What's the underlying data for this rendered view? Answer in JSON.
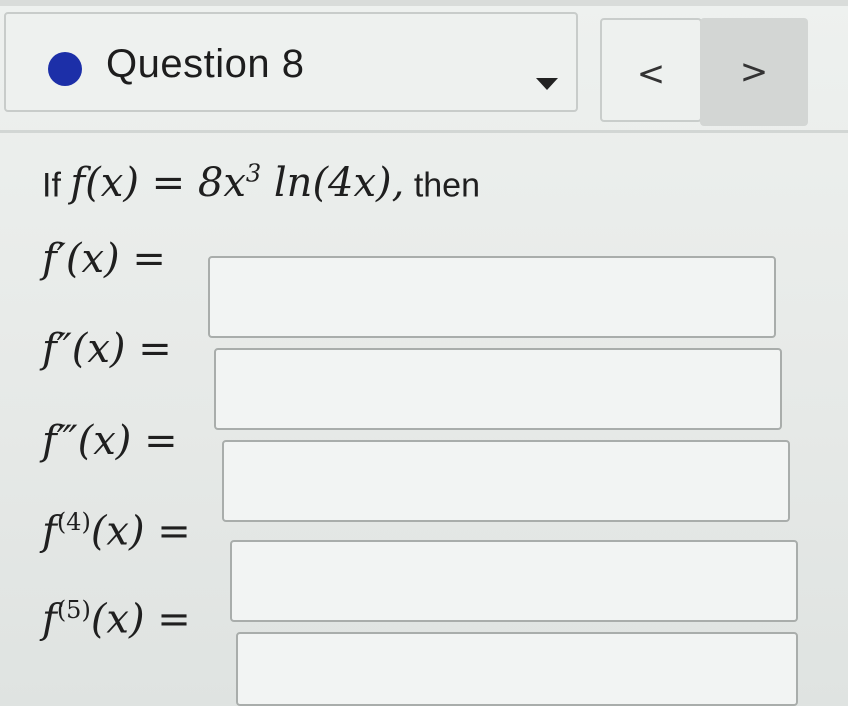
{
  "header": {
    "question_title": "Question 8"
  },
  "nav": {
    "prev_glyph": "<",
    "next_glyph": ">"
  },
  "problem": {
    "prefix": "If",
    "function_lhs": "f(x) = 8x",
    "exponent": "3",
    "function_rhs": " ln(4x),",
    "suffix": "then"
  },
  "derivatives": [
    {
      "label": "f′(x) =",
      "value": ""
    },
    {
      "label": "f″(x) =",
      "value": ""
    },
    {
      "label": "f‴(x) =",
      "value": ""
    },
    {
      "label_base": "f",
      "label_order": "(4)",
      "label_rest": "(x) =",
      "value": ""
    },
    {
      "label_base": "f",
      "label_order": "(5)",
      "label_rest": "(x) =",
      "value": ""
    }
  ],
  "colors": {
    "status_dot": "#1c2fa8",
    "background": "#e9ecea"
  },
  "icons": {
    "status": "filled-circle-icon",
    "dropdown": "caret-down-icon",
    "prev": "chevron-left-icon",
    "next": "chevron-right-icon"
  }
}
